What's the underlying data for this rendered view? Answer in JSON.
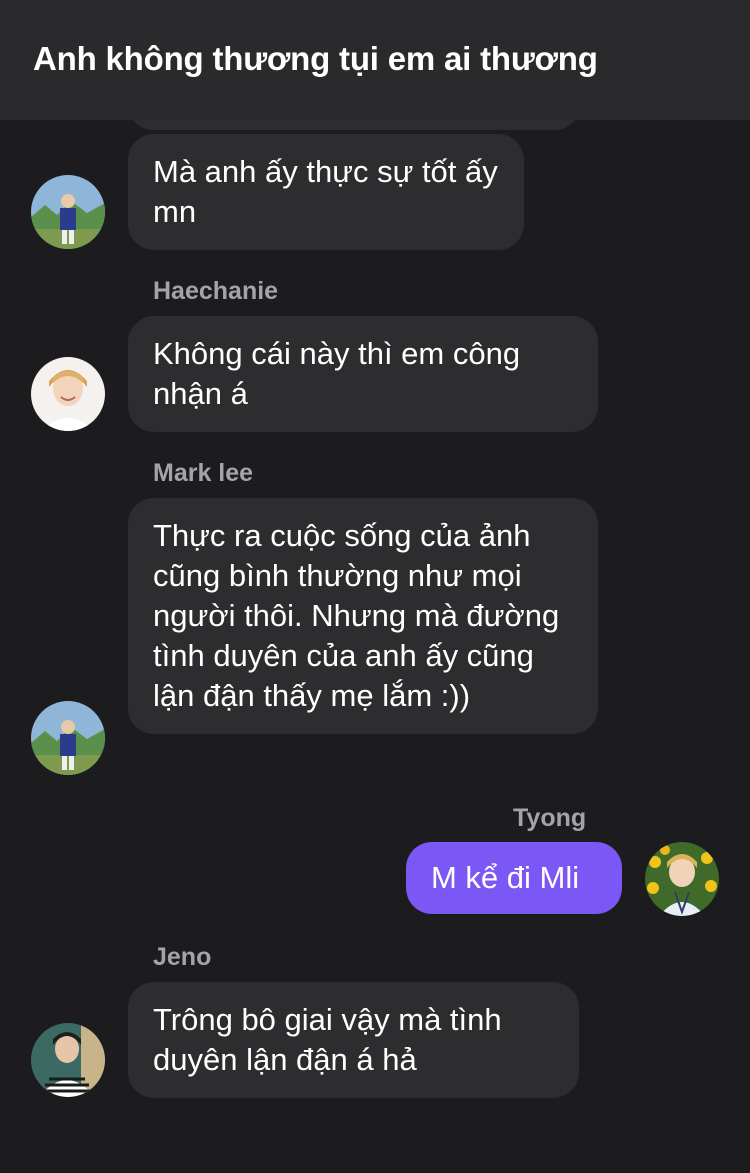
{
  "header": {
    "title": "Anh không thương tụi em ai thương"
  },
  "messages": [
    {
      "sender": "",
      "text": "Mà anh ấy thực sự tốt ấy mn",
      "mine": false
    },
    {
      "sender": "Haechanie",
      "text": "Không cái này thì em công nhận á",
      "mine": false
    },
    {
      "sender": "Mark lee",
      "text": "Thực ra cuộc sống của ảnh cũng bình thường như mọi người thôi. Nhưng mà đường tình duyên của anh ấy cũng lận đận thấy mẹ lắm :))",
      "mine": false
    },
    {
      "sender": "Tyong",
      "text": "M kể đi Mli",
      "mine": true
    },
    {
      "sender": "Jeno",
      "text": "Trông bô giai vậy mà tình duyên lận đận á hả",
      "mine": false
    }
  ],
  "colors": {
    "background": "#1c1c1e",
    "header": "#2a2a2c",
    "incoming_bubble": "#2d2d30",
    "outgoing_bubble": "#7b57f5",
    "sender_name": "#a4a4a8"
  },
  "icons": {
    "avatar_mark": "avatar-mark-lee",
    "avatar_haechan": "avatar-haechanie",
    "avatar_tyong": "avatar-tyong",
    "avatar_jeno": "avatar-jeno"
  }
}
